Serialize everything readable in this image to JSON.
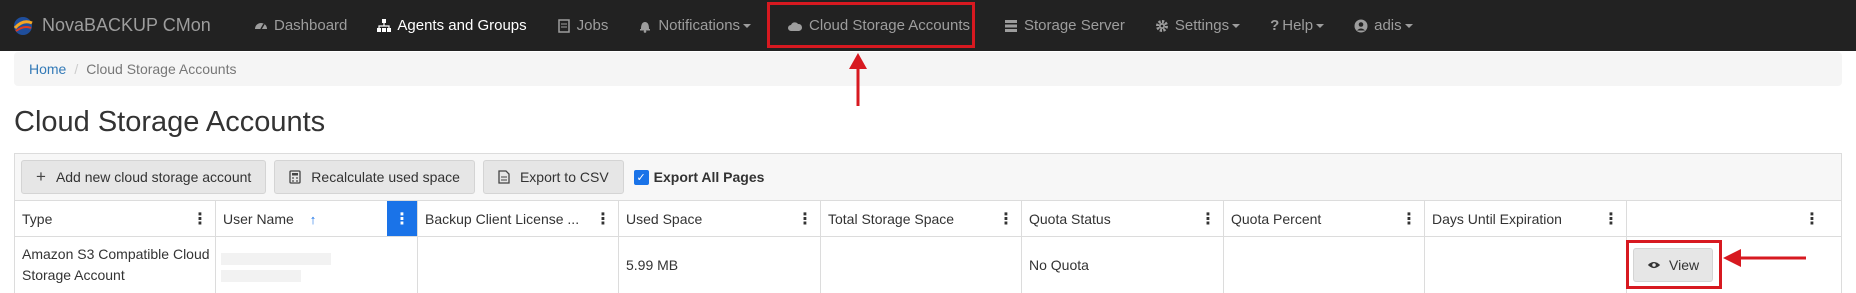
{
  "navbar": {
    "brand": "NovaBACKUP CMon",
    "items": [
      {
        "label": "Dashboard",
        "icon": "dashboard-icon",
        "active": false,
        "caret": false
      },
      {
        "label": "Agents and Groups",
        "icon": "sitemap-icon",
        "active": true,
        "caret": false
      },
      {
        "label": "Jobs",
        "icon": "jobs-icon",
        "active": false,
        "caret": false
      },
      {
        "label": "Notifications",
        "icon": "bell-icon",
        "active": false,
        "caret": true
      },
      {
        "label": "Cloud Storage Accounts",
        "icon": "cloud-icon",
        "active": false,
        "caret": false
      },
      {
        "label": "Storage Server",
        "icon": "server-icon",
        "active": false,
        "caret": false
      },
      {
        "label": "Settings",
        "icon": "gear-icon",
        "active": false,
        "caret": true
      },
      {
        "label": "Help",
        "icon": "question-icon",
        "active": false,
        "caret": true
      },
      {
        "label": "adis",
        "icon": "user-icon",
        "active": false,
        "caret": true
      }
    ]
  },
  "breadcrumb": {
    "home": "Home",
    "separator": "/",
    "current": "Cloud Storage Accounts"
  },
  "page_title": "Cloud Storage Accounts",
  "toolbar": {
    "add_label": "Add new cloud storage account",
    "recalc_label": "Recalculate used space",
    "export_label": "Export to CSV",
    "export_all_label": "Export All Pages",
    "export_all_checked": true
  },
  "columns": [
    {
      "label": "Type"
    },
    {
      "label": "User Name",
      "sort": "↑"
    },
    {
      "label": "Backup Client License ..."
    },
    {
      "label": "Used Space"
    },
    {
      "label": "Total Storage Space"
    },
    {
      "label": "Quota Status"
    },
    {
      "label": "Quota Percent"
    },
    {
      "label": "Days Until Expiration"
    },
    {
      "label": ""
    }
  ],
  "rows": [
    {
      "type": "Amazon S3 Compatible Cloud Storage Account",
      "user_name": "",
      "license": "",
      "used_space": "5.99 MB",
      "total_storage": "",
      "quota_status": "No Quota",
      "quota_percent": "",
      "days_until_expiration": "",
      "action_label": "View"
    }
  ],
  "colors": {
    "navbar_bg": "#222222",
    "accent": "#1a73e8",
    "annotation": "#d71920",
    "link": "#337ab7"
  }
}
